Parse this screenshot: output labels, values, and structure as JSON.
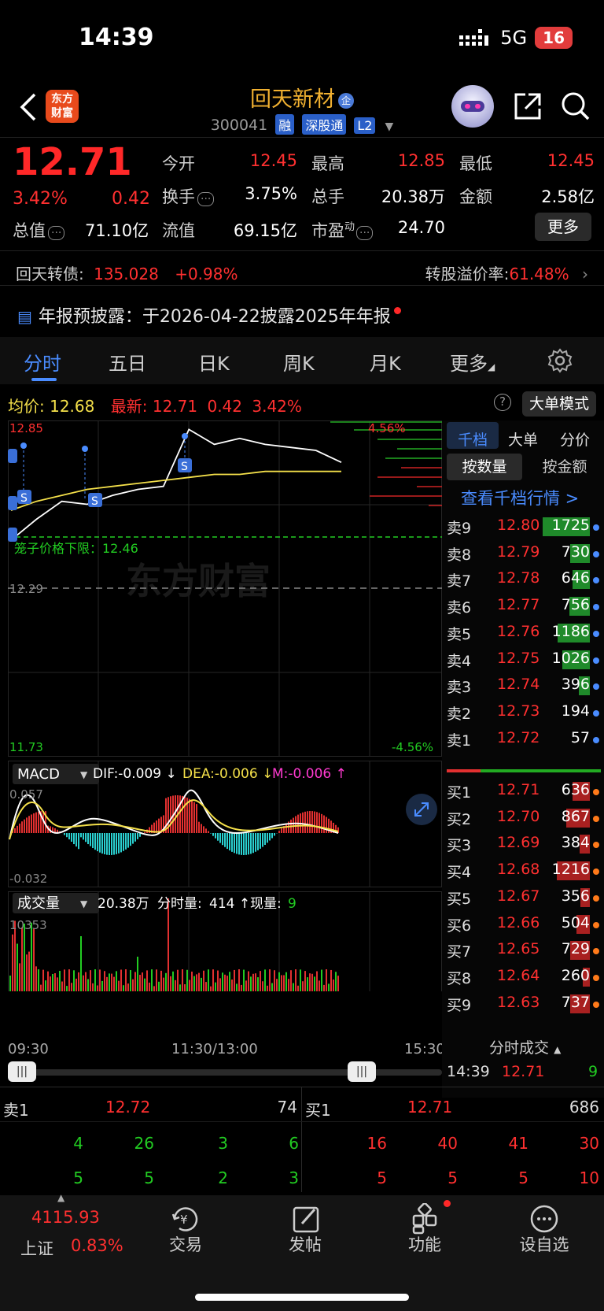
{
  "status": {
    "time": "14:39",
    "network": "5G",
    "battery": "16"
  },
  "header": {
    "logo_line1": "东方",
    "logo_line2": "财富",
    "name": "回天新材",
    "name_tag": "企",
    "code": "300041",
    "badges": [
      "融",
      "深股通",
      "L2"
    ]
  },
  "quote": {
    "price": "12.71",
    "pct": "3.42%",
    "change": "0.42",
    "total_cap_label": "总值",
    "total_cap": "71.10亿",
    "open_label": "今开",
    "open": "12.45",
    "high_label": "最高",
    "high": "12.85",
    "low_label": "最低",
    "low": "12.45",
    "turnover_label": "换手",
    "turnover": "3.75%",
    "volume_label": "总手",
    "volume": "20.38万",
    "amount_label": "金额",
    "amount": "2.58亿",
    "float_label": "流值",
    "float_cap": "69.15亿",
    "pe_label": "市盈",
    "pe_sup": "动",
    "pe": "24.70",
    "more": "更多"
  },
  "bond": {
    "label": "回天转债:",
    "price": "135.028",
    "pct": "+0.98%",
    "premium_label": "转股溢价率:",
    "premium": "61.48%"
  },
  "notice": {
    "text": "年报预披露：于2026-04-22披露2025年年报"
  },
  "tabs": [
    "分时",
    "五日",
    "日K",
    "周K",
    "月K",
    "更多"
  ],
  "chart": {
    "avg_label": "均价:",
    "avg": "12.68",
    "latest_label": "最新:",
    "latest": "12.71",
    "latest_chg": "0.42",
    "latest_pct": "3.42%",
    "bigorder": "大单模式",
    "y_top": "12.85",
    "y_top_pct": "4.56%",
    "y_mid": "12.29",
    "y_bot": "11.73",
    "y_bot_pct": "-4.56%",
    "limit_label": "笼子价格下限：12.46",
    "watermark": "东方财富",
    "macd_label": "MACD",
    "dif": "DIF:-0.009 ↓",
    "dea": "DEA:-0.006 ↓",
    "m": "M:-0.006 ↑",
    "macd_top": "0.057",
    "macd_bot": "-0.032",
    "vol_label": "成交量",
    "vol_total": "20.38万",
    "vol_min_label": "分时量:",
    "vol_min": "414 ↑",
    "vol_now_label": "现量:",
    "vol_now": "9",
    "vol_max": "10353",
    "t_start": "09:30",
    "t_mid": "11:30/13:00",
    "t_end": "15:30",
    "signal": "S"
  },
  "chart_data": {
    "type": "line",
    "title": "",
    "x": [
      "09:30",
      "11:30/13:00",
      "15:30"
    ],
    "series": [
      {
        "name": "最新",
        "values": [
          12.45,
          12.52,
          12.58,
          12.57,
          12.6,
          12.62,
          12.63,
          12.82,
          12.77,
          12.79,
          12.77,
          12.76,
          12.75,
          12.71
        ]
      },
      {
        "name": "均价",
        "values": [
          12.55,
          12.58,
          12.6,
          12.62,
          12.63,
          12.64,
          12.65,
          12.66,
          12.67,
          12.67,
          12.68,
          12.68,
          12.68,
          12.68
        ]
      }
    ],
    "ylim": [
      11.73,
      12.85
    ],
    "grid": true
  },
  "orderbook": {
    "tabs": [
      "千档",
      "大单",
      "分价"
    ],
    "sub": [
      "按数量",
      "按金额"
    ],
    "link": "查看千档行情 >",
    "sells": [
      {
        "label": "卖9",
        "price": "12.80",
        "vol": "1725",
        "bar": 1.0
      },
      {
        "label": "卖8",
        "price": "12.79",
        "vol": "730",
        "bar": 0.42
      },
      {
        "label": "卖7",
        "price": "12.78",
        "vol": "646",
        "bar": 0.37
      },
      {
        "label": "卖6",
        "price": "12.77",
        "vol": "756",
        "bar": 0.44
      },
      {
        "label": "卖5",
        "price": "12.76",
        "vol": "1186",
        "bar": 0.69
      },
      {
        "label": "卖4",
        "price": "12.75",
        "vol": "1026",
        "bar": 0.59
      },
      {
        "label": "卖3",
        "price": "12.74",
        "vol": "396",
        "bar": 0.23
      },
      {
        "label": "卖2",
        "price": "12.73",
        "vol": "194",
        "bar": 0.0
      },
      {
        "label": "卖1",
        "price": "12.72",
        "vol": "57",
        "bar": 0.0
      }
    ],
    "buys": [
      {
        "label": "买1",
        "price": "12.71",
        "vol": "636",
        "bar": 0.37
      },
      {
        "label": "买2",
        "price": "12.70",
        "vol": "867",
        "bar": 0.5
      },
      {
        "label": "买3",
        "price": "12.69",
        "vol": "384",
        "bar": 0.22
      },
      {
        "label": "买4",
        "price": "12.68",
        "vol": "1216",
        "bar": 0.7
      },
      {
        "label": "买5",
        "price": "12.67",
        "vol": "356",
        "bar": 0.2
      },
      {
        "label": "买6",
        "price": "12.66",
        "vol": "504",
        "bar": 0.29
      },
      {
        "label": "买7",
        "price": "12.65",
        "vol": "729",
        "bar": 0.42
      },
      {
        "label": "买8",
        "price": "12.64",
        "vol": "260",
        "bar": 0.15
      },
      {
        "label": "买9",
        "price": "12.63",
        "vol": "737",
        "bar": 0.42
      }
    ],
    "ticks_label": "分时成交",
    "tick": {
      "time": "14:39",
      "price": "12.71",
      "vol": "9"
    }
  },
  "bottombook": {
    "sell_label": "卖1",
    "sell_price": "12.72",
    "sell_vol": "74",
    "buy_label": "买1",
    "buy_price": "12.71",
    "buy_vol": "686",
    "sell_q1": [
      "4",
      "26",
      "3",
      "6"
    ],
    "sell_q2": [
      "5",
      "5",
      "2",
      "3"
    ],
    "buy_q1": [
      "16",
      "40",
      "41",
      "30"
    ],
    "buy_q2": [
      "5",
      "5",
      "5",
      "10"
    ]
  },
  "nav": {
    "index_value": "4115.93",
    "index_name": "上证",
    "index_pct": "0.83%",
    "items": [
      "交易",
      "发帖",
      "功能",
      "设自选"
    ]
  },
  "colors": {
    "up": "#ff3030",
    "down": "#22cc22",
    "accent": "#4a8cff",
    "avg_line": "#f4e04a"
  }
}
